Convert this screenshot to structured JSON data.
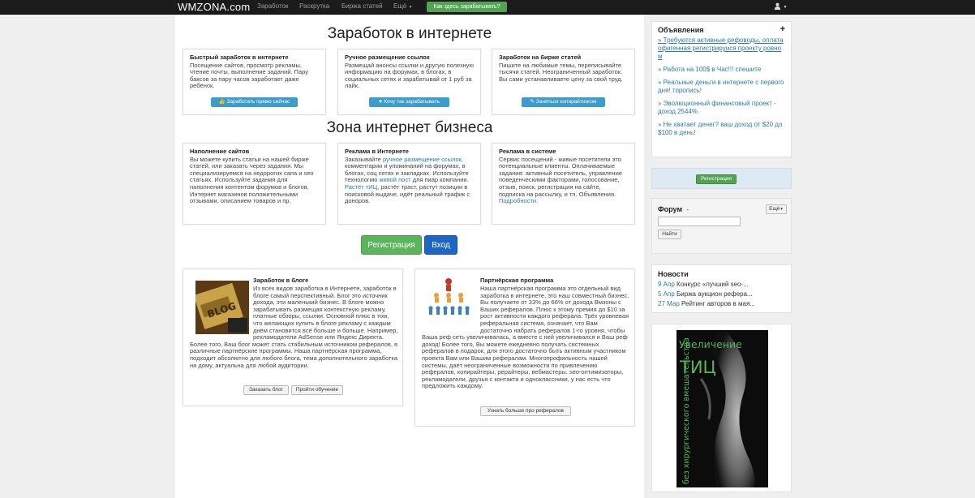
{
  "navbar": {
    "brand": "WMZONA.com",
    "items": [
      "Заработок",
      "Раскрутка",
      "Биржа статей",
      "Ещё"
    ],
    "earn_button": "Как здесь зарабатывать?"
  },
  "headings": {
    "earn_online": "Заработок в интернете",
    "business_zone": "Зона интернет бизнеса"
  },
  "cards_top": [
    {
      "title": "Быстрый заработок в интернете",
      "text": "Посещение сайтов, просмотр рекламы, чтение почты, выполнение заданий. Пару баксов за пару часов заработает даже ребёнок.",
      "button": "Заработать прямо сейчас"
    },
    {
      "title": "Ручное размещение ссылок",
      "text": "Размещай анонсы ссылки и другую полезную информацию на форумах, в блогах, в социальных сетях и зарабатывай от 1 руб за лайк.",
      "button": "Хочу так зарабатывать"
    },
    {
      "title": "Заработок на бирже статей",
      "text": "Пишите на любимые темы, переписывайте тысячи статей. Неограниченный заработок. Вы сами устанавливаете цену за свой труд.",
      "button": "Заняться копирайтингом"
    }
  ],
  "cards_mid": [
    {
      "title": "Наполнение сайтов",
      "text": "Вы можете купить статьи на нашей бирже статей, или заказать через задания. Мы специализируемся на недорогих сапа и seo статьях. Используйте задания для наполнения контентом форумов и блогов, Интернет магазинов положительными отзывами, описанием товаров и пр."
    },
    {
      "title": "Реклама в Интернете",
      "text_a": "Заказывайте ",
      "link_a": "ручное размещение ссылок",
      "text_b": ", комментарии и упоминаний на форумах, в блогах, соц сетях и закладках. Используйте технологию ",
      "link_b": "живой пост",
      "text_c": " для пиар компании. ",
      "link_c": "Растёт тИЦ",
      "text_d": ", растёт траст, растут позиции в поисковой выдаче, идёт реальный трафик с доноров."
    },
    {
      "title": "Реклама в системе",
      "text": "Сервис посещений - живые посетители это потенциальные клиенты. Оплачиваемые задания: активный посетитель, управление поведенческими факторами, голосование, отзыв, поиск, регистрация на сайте, подписка на рассылку, и тп. Объявления.",
      "link": "Подробности."
    }
  ],
  "buttons": {
    "register": "Регистрация",
    "login": "Вход"
  },
  "blog": {
    "title": "Заработок в блоге",
    "image_label": "BLOG",
    "text": "Из всех видов заработка в Интернете, заработок в блоге самый перспективный. Блог это источник дохода, эти маленький бизнес. В блоге можно зарабатывать размещая контекстную рекламу, платные обзоры, ссылки. Основной плюс в том, что желающих купить в блоге рекламу с каждым днём становится всё больше и больше. Например, рекламодатели AdSense или Яндекс Директа. Более того, Ваш блог может стать стабильным источником рефералов, в различные партнёрские программы. Наша партнёрская программа, подходит абсолютно для любого блога, тема дополнительного заработка на дому, актуальна для любой аудитории.",
    "btn_order": "Заказать блог",
    "btn_learn": "Пройти обучение"
  },
  "partner": {
    "title": "Партнёрская программа",
    "text": "Наша партнёрская программа это отдельный вид заработка в интернете, это наш совместный бизнес. Вы получаете от 33% до 66% от дохода Вмзоны с Ваших рефералов. Плюс к этому премия до $10 за рост активности каждого реферала. Трёх уровневая реферальная система, означает, что Вам достаточно набрать рефералов 1-го уровня, чтобы Ваша реф сеть увеличивалась, а вместе с ней увеличивался и Ваш реф доход! Более того, Вы можете ежедневно получать системных рефералов в подарок, для этого достаточно быть активным участником проекта Вам или Вашим рефералам. Многопрофильность нашей системы, даёт неограниченные возможности по привлечению рефералов, копирайтеры, рерайтеры, вебмастеры, seo-оптимизаторы, рекламодатели, друзья с контакта и одноклассники, у нас есть что предложить каждому.",
    "button": "Узнать больше про рефералов"
  },
  "sidebar": {
    "ads": {
      "title": "Объявления",
      "plus": "+",
      "items": [
        "» Требуются активные рефоводы, оплата офигенная регистрируися проекту ровно м",
        "» Работа на 100$ в Час!!! спешите",
        "» Реальные деньги в интернете с первого дня! торопись!",
        "» Эволюционный финансовый проект - доход 2544%",
        "» Не хватает денег? ваш доход от $20 до $100 в день!"
      ]
    },
    "register_button": "Регистрация",
    "forum": {
      "title": "Форум",
      "dash": "-",
      "more": "Ещё",
      "search_button": "Найти",
      "search_value": ""
    },
    "news": {
      "title": "Новости",
      "items": [
        {
          "date": "9 Апр",
          "text": "Конкурс «лучший seo-..."
        },
        {
          "date": "5 Апр",
          "text": "Биржа аукцион рефера..."
        },
        {
          "date": "27 Мар",
          "text": "Рейтинг авторов в мая..."
        }
      ]
    },
    "banner": {
      "line1": "Увеличение",
      "line2": "ТИЦ",
      "line3": "без хирургического вмешательства"
    }
  }
}
